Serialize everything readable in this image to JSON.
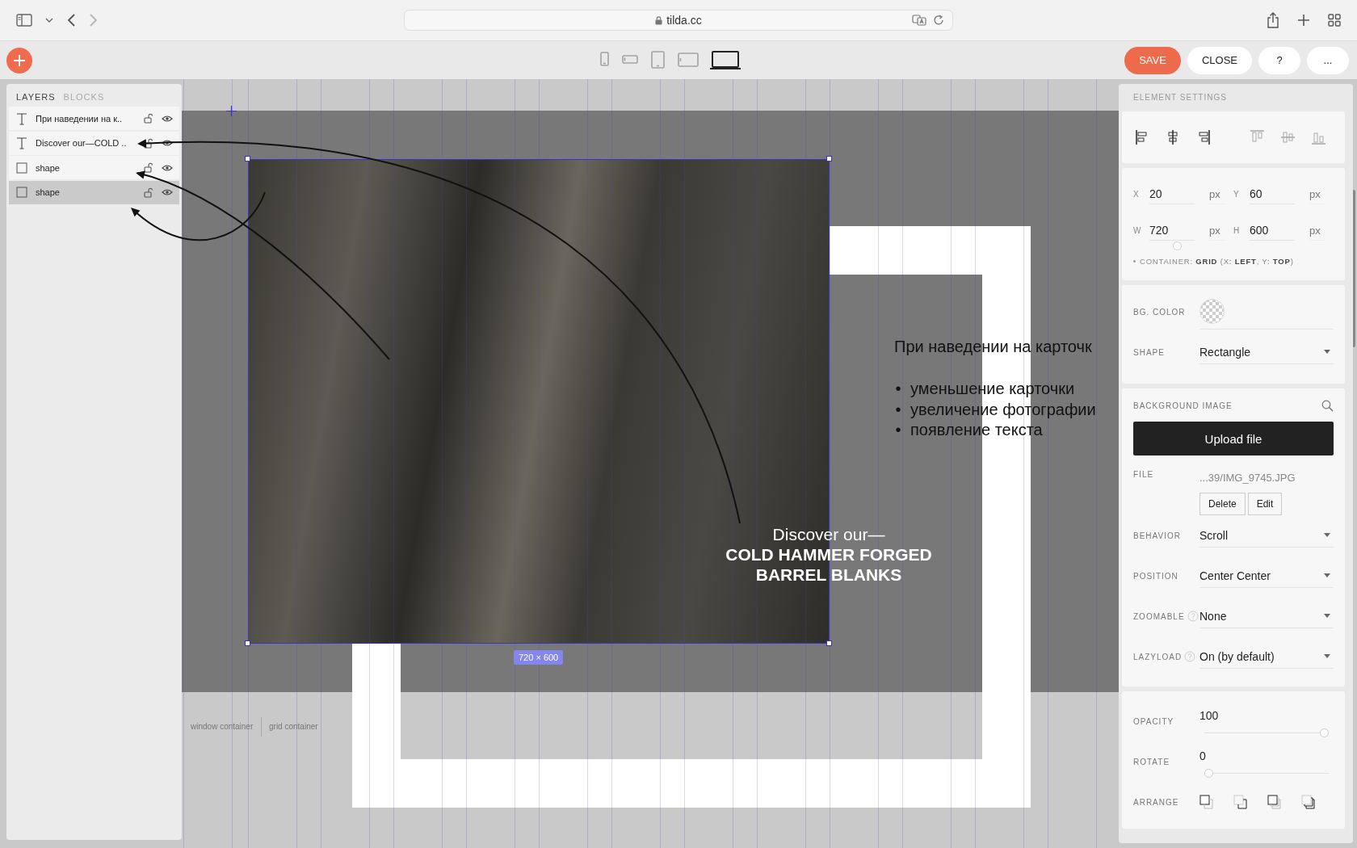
{
  "browser": {
    "url": "tilda.cc"
  },
  "devices": [
    {
      "kind": "phone",
      "selected": false
    },
    {
      "kind": "phone-landscape",
      "selected": false
    },
    {
      "kind": "tablet",
      "selected": false
    },
    {
      "kind": "tablet-landscape",
      "selected": false
    },
    {
      "kind": "laptop",
      "selected": true
    }
  ],
  "actions": [
    {
      "label": "SAVE",
      "kind": "primary"
    },
    {
      "label": "CLOSE",
      "kind": "secondary"
    },
    {
      "label": "?",
      "kind": "secondary"
    },
    {
      "label": "...",
      "kind": "secondary"
    }
  ],
  "layers_panel": {
    "tabs": [
      {
        "label": "LAYERS",
        "selected": true
      },
      {
        "label": "BLOCKS",
        "selected": false
      }
    ],
    "layers": [
      {
        "kind": "text",
        "name": "При наведении на к..",
        "selected": false
      },
      {
        "kind": "text",
        "name": "Discover our—COLD ..",
        "selected": false
      },
      {
        "kind": "shape",
        "name": "shape",
        "selected": false
      },
      {
        "kind": "shape",
        "name": "shape",
        "selected": true
      }
    ]
  },
  "canvas": {
    "heading": "При наведении на карточк",
    "bullets": [
      {
        "marker": "•",
        "text": "уменьшение карточки"
      },
      {
        "marker": "•",
        "text": "увеличение фотографии"
      },
      {
        "marker": "•",
        "text": "появление текста"
      }
    ],
    "caption_lead": "Discover our—",
    "caption_title": [
      "COLD HAMMER FORGED",
      "BARREL BLANKS"
    ],
    "size_label": "720 × 600",
    "container_labels": [
      "window container",
      "grid container"
    ]
  },
  "settings": {
    "title": "ELEMENT SETTINGS",
    "align_tools": [
      {
        "kind": "left",
        "disabled": false
      },
      {
        "kind": "center",
        "disabled": false
      },
      {
        "kind": "right",
        "disabled": false
      },
      {
        "kind": "top",
        "disabled": true
      },
      {
        "kind": "middle",
        "disabled": true
      },
      {
        "kind": "bottom",
        "disabled": true
      }
    ],
    "geometry": [
      {
        "label": "X",
        "value": "20",
        "unit": "px"
      },
      {
        "label": "Y",
        "value": "60",
        "unit": "px"
      },
      {
        "label": "W",
        "value": "720",
        "unit": "px",
        "level": 0.6
      },
      {
        "label": "H",
        "value": "600",
        "unit": "px"
      }
    ],
    "container_note": "CONTAINER: **GRID** (X: **LEFT**, Y: **TOP**)",
    "bg_color_label": "BG. COLOR",
    "shape": {
      "label": "SHAPE",
      "value": "Rectangle"
    },
    "background_image": {
      "title": "BACKGROUND IMAGE",
      "upload_button": "Upload file",
      "file_label": "FILE",
      "file_name": "...39/IMG_9745.JPG",
      "file_buttons": [
        "Delete",
        "Edit"
      ]
    },
    "selects": [
      {
        "label": "BEHAVIOR",
        "value": "Scroll",
        "help": false
      },
      {
        "label": "POSITION",
        "value": "Center Center",
        "help": false
      },
      {
        "label": "ZOOMABLE",
        "value": "None",
        "help": true
      },
      {
        "label": "LAZYLOAD",
        "value": "On (by default)",
        "help": true
      }
    ],
    "sliders": [
      {
        "label": "OPACITY",
        "value": "100",
        "level": 1
      },
      {
        "label": "ROTATE",
        "value": "0",
        "level": 0
      }
    ],
    "arrange": {
      "label": "ARRANGE",
      "tools": [
        {
          "kind": "front"
        },
        {
          "kind": "forward"
        },
        {
          "kind": "backward"
        },
        {
          "kind": "back"
        }
      ]
    }
  }
}
